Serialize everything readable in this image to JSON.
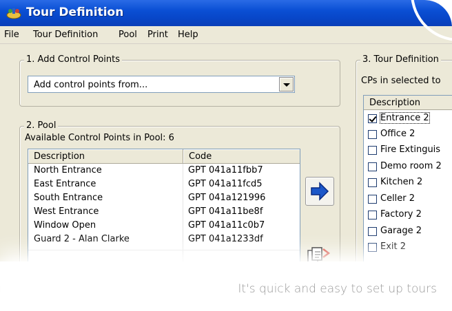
{
  "window": {
    "title": "Tour Definition",
    "icon": "tour-app-icon"
  },
  "menu": [
    "File",
    "Tour Definition",
    "Pool",
    "Print",
    "Help"
  ],
  "add_control_points": {
    "group_title": "1. Add Control Points",
    "combo_value": "Add control points from..."
  },
  "pool": {
    "group_title": "2. Pool",
    "available_label": "Available Control Points in Pool: 6",
    "columns": [
      "Description",
      "Code"
    ],
    "rows": [
      {
        "description": "North Entrance",
        "code": "GPT 041a11fbb7"
      },
      {
        "description": "East Entrance",
        "code": "GPT 041a11fcd5"
      },
      {
        "description": "South Entrance",
        "code": "GPT 041a121996"
      },
      {
        "description": "West Entrance",
        "code": "GPT 041a11be8f"
      },
      {
        "description": "Window Open",
        "code": "GPT 041a11c0b7"
      },
      {
        "description": "Guard 2 - Alan Clarke",
        "code": "GPT 041a1233df"
      }
    ]
  },
  "tour_definition": {
    "group_title": "3. Tour Definition",
    "cps_label": "CPs in selected to",
    "column": "Description",
    "items": [
      {
        "label": "Entrance 2",
        "checked": true
      },
      {
        "label": "Office 2",
        "checked": false
      },
      {
        "label": "Fire Extinguis",
        "checked": false
      },
      {
        "label": "Demo room 2",
        "checked": false
      },
      {
        "label": "Kitchen 2",
        "checked": false
      },
      {
        "label": "Celler 2",
        "checked": false
      },
      {
        "label": "Factory 2",
        "checked": false
      },
      {
        "label": "Garage 2",
        "checked": false
      },
      {
        "label": "Exit 2",
        "checked": false
      }
    ]
  },
  "buttons": {
    "add_to_tour": "arrow-right-icon",
    "copy": "copy-document-icon"
  },
  "caption": "It's quick and easy to set up tours",
  "colors": {
    "titlebar": "#0a4fd4",
    "window_bg": "#ece9d8",
    "arrow": "#1c57c9"
  }
}
